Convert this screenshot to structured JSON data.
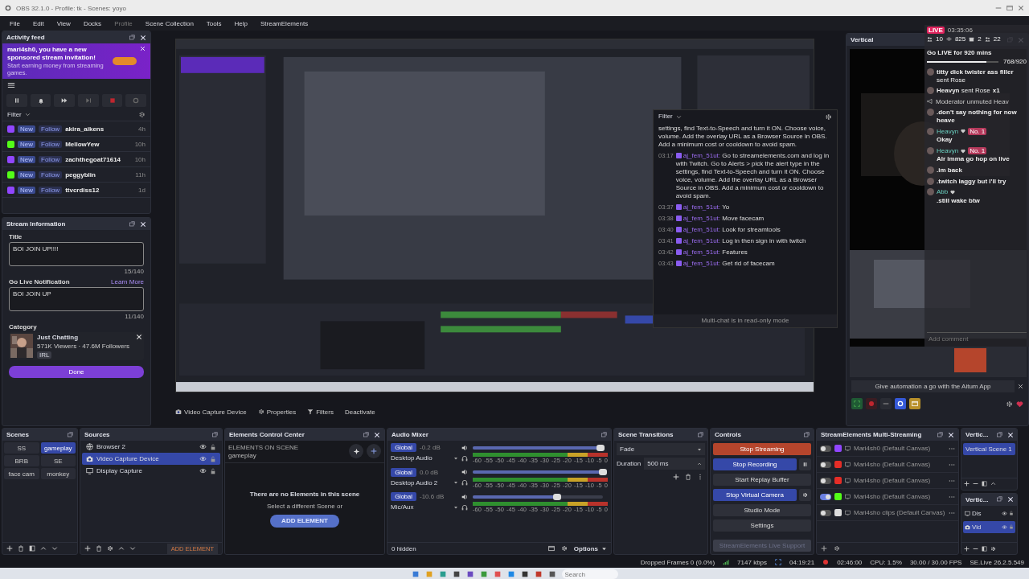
{
  "window": {
    "title": "OBS 32.1.0 - Profile: tk - Scenes: yoyo"
  },
  "menu": [
    {
      "label": "File",
      "disabled": false
    },
    {
      "label": "Edit",
      "disabled": false
    },
    {
      "label": "View",
      "disabled": false
    },
    {
      "label": "Docks",
      "disabled": false
    },
    {
      "label": "Profile",
      "disabled": true
    },
    {
      "label": "Scene Collection",
      "disabled": false
    },
    {
      "label": "Tools",
      "disabled": false
    },
    {
      "label": "Help",
      "disabled": false
    },
    {
      "label": "StreamElements",
      "disabled": false
    }
  ],
  "activity_feed": {
    "title": "Activity feed",
    "banner": {
      "text": "mari4sh0, you have a new sponsored stream invitation!",
      "subtext": "Start earning money from streaming games."
    },
    "filter": "Filter",
    "items": [
      {
        "color": "#9146ff",
        "badge": "New",
        "type": "Follow",
        "user": "akira_aikens",
        "time": "4h"
      },
      {
        "color": "#53fc18",
        "badge": "New",
        "type": "Follow",
        "user": "MellowYew",
        "time": "10h"
      },
      {
        "color": "#9146ff",
        "badge": "New",
        "type": "Follow",
        "user": "zachthegoat71614",
        "time": "10h"
      },
      {
        "color": "#53fc18",
        "badge": "New",
        "type": "Follow",
        "user": "peggyblin",
        "time": "11h"
      },
      {
        "color": "#9146ff",
        "badge": "New",
        "type": "Follow",
        "user": "ttvcrdiss12",
        "time": "1d"
      }
    ]
  },
  "stream_information": {
    "title": "Stream Information",
    "fields": [
      {
        "label": "Title",
        "value": "BOI JOIN UP!!!!",
        "count": "15/140"
      },
      {
        "label": "Go Live Notification",
        "link": "Learn More",
        "value": "BOI JOIN UP",
        "count": "11/140"
      }
    ],
    "category": {
      "label": "Category",
      "name": "Just Chatting",
      "stats": "571K Viewers · 47.6M Followers",
      "tag": "IRL"
    },
    "done": "Done"
  },
  "source_toolbar": [
    "Video Capture Device",
    "Properties",
    "Filters",
    "Deactivate"
  ],
  "multi_chat": {
    "filter": "Filter",
    "intro": "settings, find Text-to-Speech and turn it ON. Choose voice, volume. Add the overlay URL as a Browser Source in OBS. Add a minimum cost or cooldown to avoid spam.",
    "messages": [
      {
        "time": "03:17",
        "user": "aj_fem_51ut:",
        "text": "Go to streamelements.com and log in with Twitch. Go to Alerts > pick the alert type in the settings, find Text-to-Speech and turn it ON. Choose voice, volume. Add the overlay URL as a Browser Source in OBS. Add a minimum cost or cooldown to avoid spam."
      },
      {
        "time": "03:37",
        "user": "aj_fem_51ut:",
        "text": "Yo"
      },
      {
        "time": "03:38",
        "user": "aj_fem_51ut:",
        "text": "Move facecam"
      },
      {
        "time": "03:40",
        "user": "aj_fem_51ut:",
        "text": "Look for streamtools"
      },
      {
        "time": "03:41",
        "user": "aj_fem_51ut:",
        "text": "Log in then sign in with twitch"
      },
      {
        "time": "03:42",
        "user": "aj_fem_51ut:",
        "text": "Features"
      },
      {
        "time": "03:43",
        "user": "aj_fem_51ut:",
        "text": "Get rid of facecam"
      }
    ],
    "footer": "Multi-chat is in read-only mode"
  },
  "vertical": {
    "title": "Vertical",
    "banner": "Give automation a go with the Aitum App"
  },
  "live_overlay": {
    "badge": "LIVE",
    "timer": "03:35:06",
    "stats": [
      "10",
      "825",
      "2",
      "22"
    ],
    "goal": "Go LIVE for 920 mins",
    "level": 0.835,
    "goal_count": "768/920",
    "messages": [
      {
        "kind": "gift",
        "user": "titty dick twister ass filler",
        "text": "sent Rose"
      },
      {
        "kind": "gift",
        "user": "Heavyn",
        "text": "sent Rose",
        "count": "x1"
      },
      {
        "kind": "system",
        "text": "Moderator unmuted Heav"
      },
      {
        "kind": "chat",
        "text": ".don't say nothing for now heave"
      },
      {
        "kind": "chat",
        "user": "Heavyn",
        "badge": "No. 1",
        "text": "Okay"
      },
      {
        "kind": "chat",
        "user": "Heavyn",
        "badge": "No. 1",
        "text": "Alr imma go hop on live"
      },
      {
        "kind": "chat",
        "text": ".im back"
      },
      {
        "kind": "chat",
        "text": ".twitch laggy but I'll try"
      },
      {
        "kind": "chat",
        "user": "Abb",
        "text": ".still wake btw"
      }
    ],
    "placeholder": "Add comment"
  },
  "scenes": {
    "title": "Scenes",
    "items": [
      {
        "label": "SS",
        "selected": false
      },
      {
        "label": "gameplay",
        "selected": true
      },
      {
        "label": "BRB",
        "selected": false
      },
      {
        "label": "SE",
        "selected": false
      },
      {
        "label": "face cam",
        "selected": false
      },
      {
        "label": "monkey",
        "selected": false
      }
    ]
  },
  "sources": {
    "title": "Sources",
    "items": [
      {
        "kind": "browser",
        "label": "Browser 2",
        "selected": false
      },
      {
        "kind": "camera",
        "label": "Video Capture Device",
        "selected": true
      },
      {
        "kind": "display",
        "label": "Display Capture",
        "selected": false
      }
    ],
    "add": "ADD ELEMENT"
  },
  "elements": {
    "title": "Elements Control Center",
    "heading": "ELEMENTS ON SCENE",
    "scene": "gameplay",
    "empty": "There are no Elements in this scene",
    "hint": "Select a different Scene or",
    "button": "ADD ELEMENT"
  },
  "audio_mixer": {
    "title": "Audio Mixer",
    "channels": [
      {
        "badge": "Global",
        "name": "Desktop Audio",
        "reading": "-0.2 dB",
        "level": 0.98,
        "scale": [
          "-60",
          "-55",
          "-50",
          "-45",
          "-40",
          "-35",
          "-30",
          "-25",
          "-20",
          "-15",
          "-10",
          "-5",
          "0"
        ]
      },
      {
        "badge": "Global",
        "name": "Desktop Audio 2",
        "reading": "0.0 dB",
        "level": 1.0,
        "scale": [
          "-60",
          "-55",
          "-50",
          "-45",
          "-40",
          "-35",
          "-30",
          "-25",
          "-20",
          "-15",
          "-10",
          "-5",
          "0"
        ]
      },
      {
        "badge": "Global",
        "name": "Mic/Aux",
        "reading": "-10.6 dB",
        "level": 0.65,
        "scale": [
          "-60",
          "-55",
          "-50",
          "-45",
          "-40",
          "-35",
          "-30",
          "-25",
          "-20",
          "-15",
          "-10",
          "-5",
          "0"
        ]
      }
    ],
    "hidden": "0 hidden",
    "options": "Options"
  },
  "scene_transitions": {
    "title": "Scene Transitions",
    "transition": "Fade",
    "duration_label": "Duration",
    "duration": "500 ms"
  },
  "controls": {
    "title": "Controls",
    "buttons": [
      {
        "kind": "danger",
        "label": "Stop Streaming",
        "pause_button": false,
        "settings_button": false
      },
      {
        "kind": "active",
        "label": "Stop Recording",
        "pause_button": true,
        "settings_button": false
      },
      {
        "kind": "normal",
        "label": "Start Replay Buffer",
        "pause_button": false,
        "settings_button": false
      },
      {
        "kind": "active",
        "label": "Stop Virtual Camera",
        "pause_button": false,
        "settings_button": true
      },
      {
        "kind": "normal",
        "label": "Studio Mode",
        "pause_button": false,
        "settings_button": false
      },
      {
        "kind": "normal",
        "label": "Settings",
        "pause_button": false,
        "settings_button": false
      },
      {
        "kind": "disabled",
        "label": "StreamElements Live Support",
        "pause_button": false,
        "settings_button": false
      }
    ]
  },
  "multistream": {
    "title": "StreamElements Multi-Streaming",
    "rows": [
      {
        "on": false,
        "color": "#9146ff",
        "account": "Mari4sh0 (Default Canvas)"
      },
      {
        "on": false,
        "color": "#e52d27",
        "account": "Mari4sho (Default Canvas)"
      },
      {
        "on": false,
        "color": "#e52d27",
        "account": "Mari4sho (Default Canvas)"
      },
      {
        "on": true,
        "color": "#53fc18",
        "account": "Mari4sho (Default Canvas)"
      },
      {
        "on": false,
        "color": "#dddddd",
        "account": "Mari4sho clips (Default Canvas)"
      }
    ]
  },
  "vertical_scenes": {
    "title": "Vertic...",
    "items": [
      {
        "label": "Vertical Scene 1",
        "selected": true
      }
    ]
  },
  "vertical_sources": {
    "title": "Vertic...",
    "items": [
      {
        "kind": "display",
        "label": "Dis",
        "selected": false
      },
      {
        "kind": "camera",
        "label": "Vid",
        "selected": true
      }
    ]
  },
  "status_bar": {
    "dropped": "Dropped Frames 0 (0.0%)",
    "bitrate": "7147 kbps",
    "stream_time": "04:19:21",
    "record_time": "02:46:00",
    "cpu": "CPU: 1.5%",
    "fps": "30.00 / 30.00 FPS",
    "version": "SE.Live 26.2.5.549"
  },
  "taskbar": {
    "search_placeholder": "Search"
  }
}
